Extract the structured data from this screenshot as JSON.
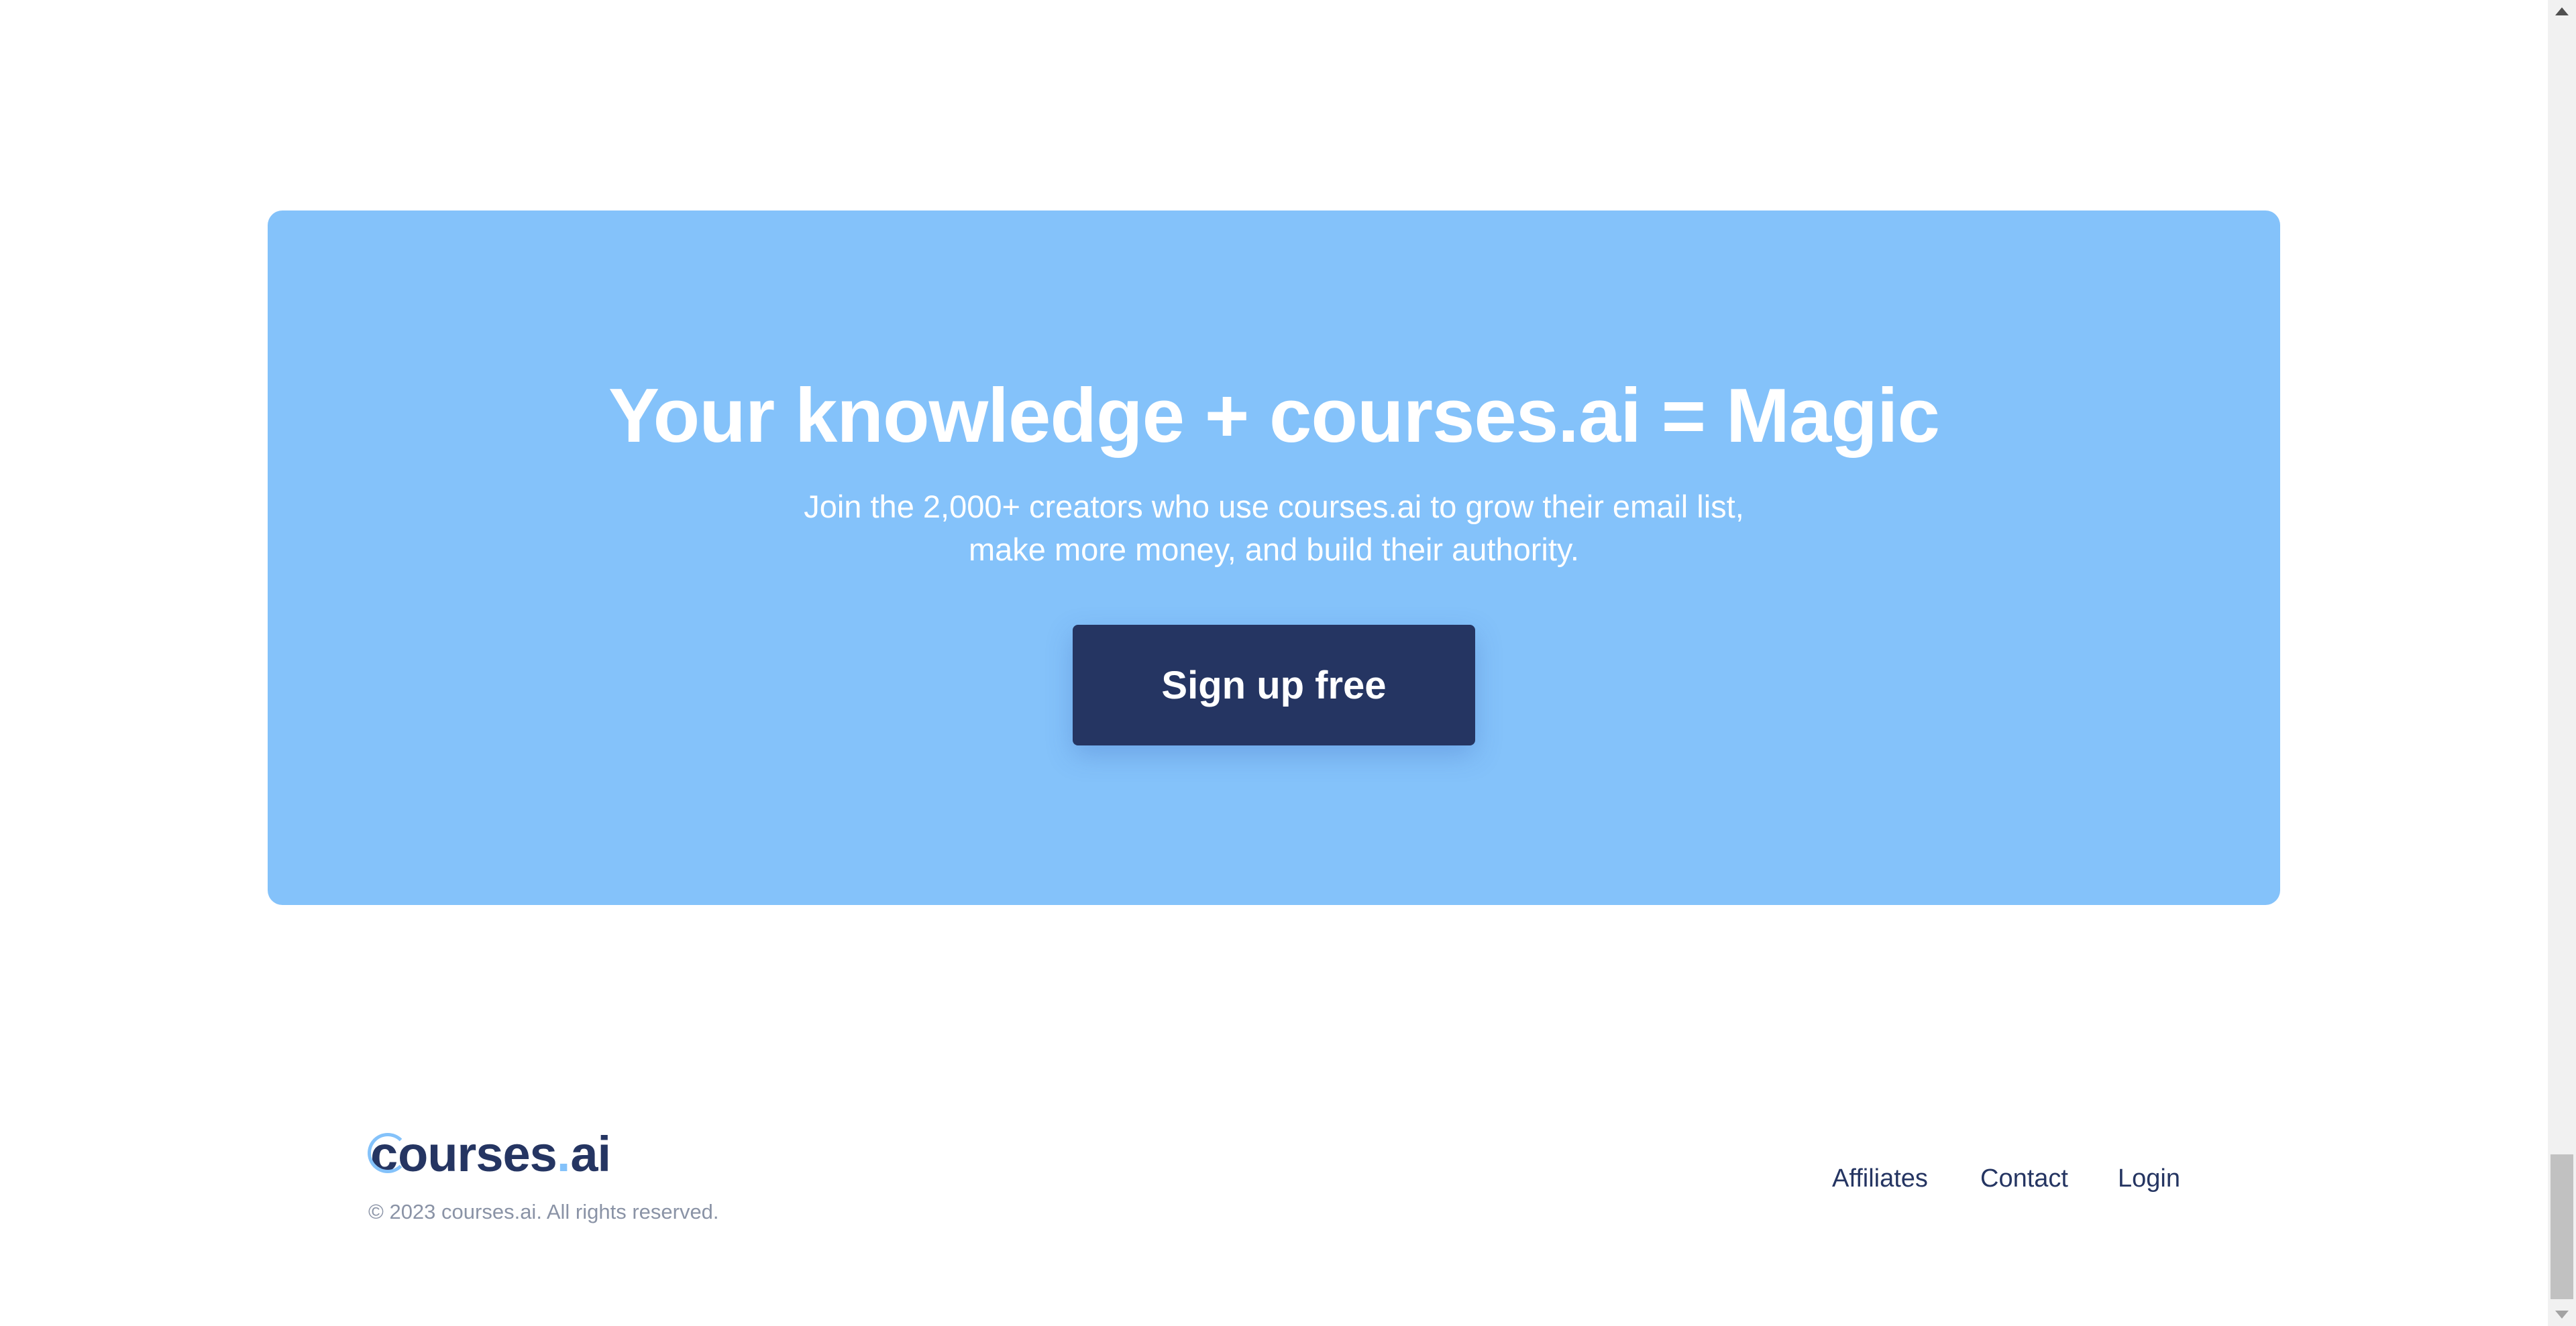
{
  "cta": {
    "title": "Your knowledge + courses.ai = Magic",
    "subtitle_line1": "Join the 2,000+ creators who use courses.ai to grow their email list,",
    "subtitle_line2": "make more money, and build their authority.",
    "button_label": "Sign up free"
  },
  "footer": {
    "logo": {
      "first_letter": "c",
      "word": "ourses",
      "dot": ".",
      "suffix": "ai"
    },
    "copyright": "© 2023 courses.ai. All rights reserved.",
    "nav": {
      "affiliates": "Affiliates",
      "contact": "Contact",
      "login": "Login"
    }
  },
  "colors": {
    "cta_background": "#84c2fa",
    "button_background": "#253562",
    "brand_navy": "#253562",
    "brand_light_blue": "#84c2fa",
    "copyright_text": "#8a93a6"
  },
  "icons": {
    "scroll_up": "triangle-up-icon",
    "scroll_down": "triangle-down-icon"
  }
}
